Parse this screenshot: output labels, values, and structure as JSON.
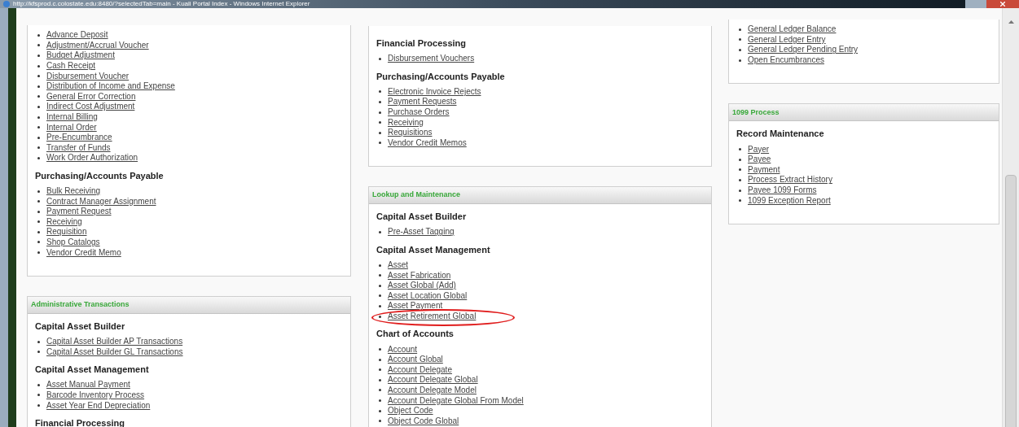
{
  "window": {
    "title": "http://kfsprod.c.colostate.edu:8480/?selectedTab=main - Kuali Portal Index - Windows Internet Explorer"
  },
  "columns": [
    {
      "panels": [
        {
          "sections": [
            {
              "links": [
                {
                  "label": "Advance Deposit",
                  "circled": false
                },
                {
                  "label": "Adjustment/Accrual Voucher",
                  "circled": false
                },
                {
                  "label": "Budget Adjustment",
                  "circled": false
                },
                {
                  "label": "Cash Receipt",
                  "circled": false
                },
                {
                  "label": "Disbursement Voucher",
                  "circled": false
                },
                {
                  "label": "Distribution of Income and Expense",
                  "circled": false
                },
                {
                  "label": "General Error Correction",
                  "circled": false
                },
                {
                  "label": "Indirect Cost Adjustment",
                  "circled": false
                },
                {
                  "label": "Internal Billing",
                  "circled": false
                },
                {
                  "label": "Internal Order",
                  "circled": false
                },
                {
                  "label": "Pre-Encumbrance",
                  "circled": false
                },
                {
                  "label": "Transfer of Funds",
                  "circled": false
                },
                {
                  "label": "Work Order Authorization",
                  "circled": false
                }
              ]
            },
            {
              "heading": "Purchasing/Accounts Payable",
              "links": [
                {
                  "label": "Bulk Receiving",
                  "circled": false
                },
                {
                  "label": "Contract Manager Assignment",
                  "circled": false
                },
                {
                  "label": "Payment Request",
                  "circled": false
                },
                {
                  "label": "Receiving",
                  "circled": false
                },
                {
                  "label": "Requisition",
                  "circled": false
                },
                {
                  "label": "Shop Catalogs",
                  "circled": false
                },
                {
                  "label": "Vendor Credit Memo",
                  "circled": false
                }
              ]
            }
          ]
        },
        {
          "title": "Administrative Transactions",
          "sections": [
            {
              "heading": "Capital Asset Builder",
              "links": [
                {
                  "label": "Capital Asset Builder AP Transactions",
                  "circled": false
                },
                {
                  "label": "Capital Asset Builder GL Transactions",
                  "circled": false
                }
              ]
            },
            {
              "heading": "Capital Asset Management",
              "links": [
                {
                  "label": "Asset Manual Payment",
                  "circled": false
                },
                {
                  "label": "Barcode Inventory Process",
                  "circled": false
                },
                {
                  "label": "Asset Year End Depreciation",
                  "circled": false
                }
              ]
            },
            {
              "heading": "Financial Processing"
            }
          ]
        }
      ]
    },
    {
      "panels": [
        {
          "sections": [
            {
              "heading": "Financial Processing",
              "links": [
                {
                  "label": "Disbursement Vouchers",
                  "circled": false
                }
              ]
            },
            {
              "heading": "Purchasing/Accounts Payable",
              "links": [
                {
                  "label": "Electronic Invoice Rejects",
                  "circled": false
                },
                {
                  "label": "Payment Requests",
                  "circled": false
                },
                {
                  "label": "Purchase Orders",
                  "circled": false
                },
                {
                  "label": "Receiving",
                  "circled": false
                },
                {
                  "label": "Requisitions",
                  "circled": false
                },
                {
                  "label": "Vendor Credit Memos",
                  "circled": false
                }
              ]
            }
          ]
        },
        {
          "title": "Lookup and Maintenance",
          "sections": [
            {
              "heading": "Capital Asset Builder",
              "links": [
                {
                  "label": "Pre-Asset Tagging",
                  "circled": false
                }
              ]
            },
            {
              "heading": "Capital Asset Management",
              "links": [
                {
                  "label": "Asset",
                  "circled": false
                },
                {
                  "label": "Asset Fabrication",
                  "circled": false
                },
                {
                  "label": "Asset Global (Add)",
                  "circled": false
                },
                {
                  "label": "Asset Location Global",
                  "circled": false
                },
                {
                  "label": "Asset Payment",
                  "circled": false
                },
                {
                  "label": "Asset Retirement Global",
                  "circled": true
                }
              ]
            },
            {
              "heading": "Chart of Accounts",
              "links": [
                {
                  "label": "Account",
                  "circled": false
                },
                {
                  "label": "Account Global",
                  "circled": false
                },
                {
                  "label": "Account Delegate",
                  "circled": false
                },
                {
                  "label": "Account Delegate Global",
                  "circled": false
                },
                {
                  "label": "Account Delegate Model",
                  "circled": false
                },
                {
                  "label": "Account Delegate Global From Model",
                  "circled": false
                },
                {
                  "label": "Object Code",
                  "circled": false
                },
                {
                  "label": "Object Code Global",
                  "circled": false
                }
              ]
            }
          ]
        }
      ]
    },
    {
      "panels": [
        {
          "sections": [
            {
              "links": [
                {
                  "label": "General Ledger Balance",
                  "circled": false
                },
                {
                  "label": "General Ledger Entry",
                  "circled": false
                },
                {
                  "label": "General Ledger Pending Entry",
                  "circled": false
                },
                {
                  "label": "Open Encumbrances",
                  "circled": false
                }
              ]
            }
          ]
        },
        {
          "title": "1099 Process",
          "sections": [
            {
              "heading": "Record Maintenance",
              "links": [
                {
                  "label": "Payer",
                  "circled": false
                },
                {
                  "label": "Payee",
                  "circled": false
                },
                {
                  "label": "Payment",
                  "circled": false
                },
                {
                  "label": "Process Extract History",
                  "circled": false
                },
                {
                  "label": "Payee 1099 Forms",
                  "circled": false
                },
                {
                  "label": "1099 Exception Report",
                  "circled": false
                }
              ]
            }
          ]
        }
      ]
    }
  ]
}
